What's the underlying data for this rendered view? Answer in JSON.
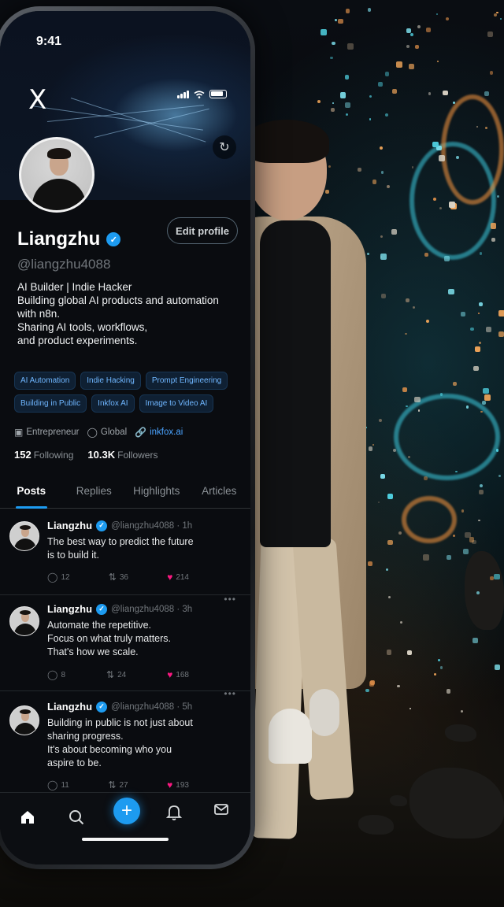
{
  "status": {
    "time": "9:41"
  },
  "app": {
    "logo": "X",
    "logo_icon": "x-logo-icon",
    "refresh_icon": "refresh-icon"
  },
  "profile": {
    "name": "Liangzhu",
    "handle": "@liangzhu4088",
    "edit_label": "Edit profile",
    "bio": [
      "AI Builder | Indie Hacker",
      "Building global AI products and automation",
      "with n8n.",
      "Sharing AI tools, workflows,",
      "and product experiments."
    ],
    "tags": [
      "AI Automation",
      "Indie Hacking",
      "Prompt Engineering",
      "Building in Public",
      "Inkfox AI",
      "Image to Video AI"
    ],
    "meta": {
      "occupation": "Entrepreneur",
      "location": "Global",
      "website": "inkfox.ai"
    },
    "following_count": "152",
    "following_label": "Following",
    "followers_count": "10.3K",
    "followers_label": "Followers"
  },
  "tabs": [
    "Posts",
    "Replies",
    "Highlights",
    "Articles"
  ],
  "active_tab": "Posts",
  "posts": [
    {
      "name": "Liangzhu",
      "handle": "@liangzhu4088 · 1h",
      "text": [
        "The best way to predict the future",
        "is to build it."
      ],
      "replies": "12",
      "reposts": "36",
      "likes": "214"
    },
    {
      "name": "Liangzhu",
      "handle": "@liangzhu4088 · 3h",
      "text": [
        "Automate the repetitive.",
        "Focus on what truly matters.",
        "That's how we scale."
      ],
      "replies": "8",
      "reposts": "24",
      "likes": "168"
    },
    {
      "name": "Liangzhu",
      "handle": "@liangzhu4088 · 5h",
      "text": [
        "Building in public is not just about",
        "sharing progress.",
        "It's about becoming who you",
        "aspire to be."
      ],
      "replies": "11",
      "reposts": "27",
      "likes": "193"
    }
  ],
  "nav": {
    "items": [
      "home-icon",
      "search-icon",
      "compose-icon",
      "notifications-icon",
      "messages-icon"
    ],
    "compose_label": "+"
  },
  "colors": {
    "accent": "#1d9bf0",
    "like": "#f91880",
    "tag_text": "#6fb6ff",
    "background": "#0a0c10"
  }
}
